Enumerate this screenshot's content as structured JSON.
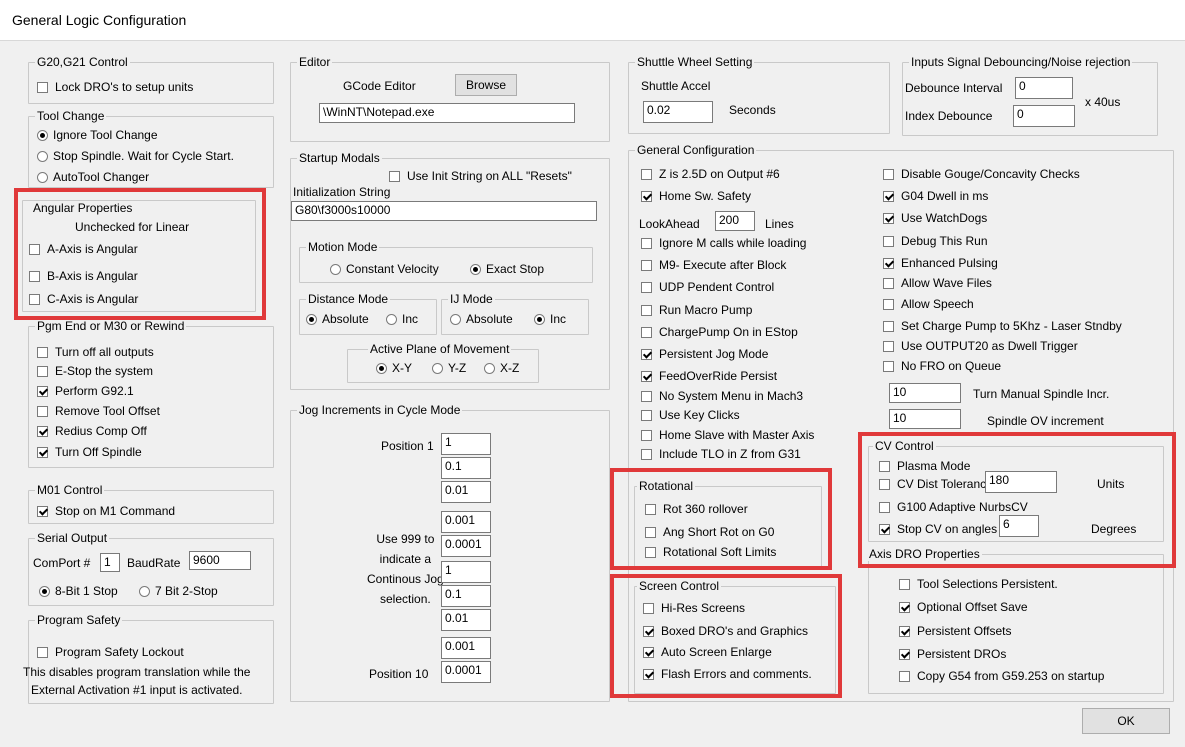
{
  "window": {
    "title": "General Logic Configuration"
  },
  "g20": {
    "title": "G20,G21 Control",
    "lock": {
      "label": "Lock DRO's to setup units",
      "checked": false
    }
  },
  "tool_change": {
    "title": "Tool Change",
    "options": [
      {
        "label": "Ignore Tool Change",
        "selected": true
      },
      {
        "label": "Stop Spindle. Wait for Cycle Start.",
        "selected": false
      },
      {
        "label": "AutoTool Changer",
        "selected": false
      }
    ]
  },
  "angular": {
    "title": "Angular Properties",
    "note": "Unchecked for Linear",
    "items": [
      {
        "label": "A-Axis is Angular",
        "checked": false
      },
      {
        "label": "B-Axis is Angular",
        "checked": false
      },
      {
        "label": "C-Axis is Angular",
        "checked": false
      }
    ]
  },
  "pgm_end": {
    "title": "Pgm End or M30 or Rewind",
    "items": [
      {
        "label": "Turn off all outputs",
        "checked": false
      },
      {
        "label": "E-Stop the system",
        "checked": false
      },
      {
        "label": "Perform G92.1",
        "checked": true
      },
      {
        "label": "Remove Tool Offset",
        "checked": false
      },
      {
        "label": "Redius Comp Off",
        "checked": true
      },
      {
        "label": "Turn Off Spindle",
        "checked": true
      }
    ]
  },
  "m01": {
    "title": "M01 Control",
    "stop": {
      "label": "Stop on M1 Command",
      "checked": true
    }
  },
  "serial": {
    "title": "Serial Output",
    "comport_label": "ComPort #",
    "comport_value": "1",
    "baud_label": "BaudRate",
    "baud_value": "9600",
    "options": [
      {
        "label": "8-Bit 1 Stop",
        "selected": true
      },
      {
        "label": "7 Bit 2-Stop",
        "selected": false
      }
    ]
  },
  "safety": {
    "title": "Program Safety",
    "lockout": {
      "label": "Program Safety Lockout",
      "checked": false
    },
    "note1": "This disables program translation while the",
    "note2": "External Activation #1 input is activated."
  },
  "editor": {
    "title": "Editor",
    "gcode_label": "GCode Editor",
    "browse_label": "Browse",
    "path": "\\WinNT\\Notepad.exe"
  },
  "startup": {
    "title": "Startup Modals",
    "use_init": {
      "label": "Use Init String on ALL  \"Resets\"",
      "checked": false
    },
    "init_label": "Initialization String",
    "init_value": "G80\\f3000s10000",
    "motion": {
      "title": "Motion Mode",
      "options": [
        {
          "label": "Constant Velocity",
          "selected": false
        },
        {
          "label": "Exact Stop",
          "selected": true
        }
      ]
    },
    "distance": {
      "title": "Distance Mode",
      "options": [
        {
          "label": "Absolute",
          "selected": true
        },
        {
          "label": "Inc",
          "selected": false
        }
      ]
    },
    "ij": {
      "title": "IJ Mode",
      "options": [
        {
          "label": "Absolute",
          "selected": false
        },
        {
          "label": "Inc",
          "selected": true
        }
      ]
    },
    "plane": {
      "title": "Active Plane of Movement",
      "options": [
        {
          "label": "X-Y",
          "selected": true
        },
        {
          "label": "Y-Z",
          "selected": false
        },
        {
          "label": "X-Z",
          "selected": false
        }
      ]
    }
  },
  "jog": {
    "title": "Jog Increments in Cycle Mode",
    "pos1_label": "Position 1",
    "pos10_label": "Position 10",
    "note": [
      "Use 999 to",
      "indicate a",
      "Continous Jog",
      "selection."
    ],
    "values": [
      "1",
      "0.1",
      "0.01",
      "0.001",
      "0.0001",
      "1",
      "0.1",
      "0.01",
      "0.001",
      "0.0001"
    ]
  },
  "shuttle": {
    "title": "Shuttle Wheel Setting",
    "accel_label": "Shuttle Accel",
    "accel_value": "0.02",
    "seconds_label": "Seconds"
  },
  "debounce": {
    "title": "Inputs Signal Debouncing/Noise rejection",
    "interval_label": "Debounce Interval",
    "interval_value": "0",
    "index_label": "Index Debounce",
    "index_value": "0",
    "unit": "x 40us"
  },
  "general": {
    "title": "General Configuration",
    "left": [
      {
        "label": "Z is 2.5D on Output #6",
        "checked": false
      },
      {
        "label": "Home Sw. Safety",
        "checked": true
      }
    ],
    "lookahead_label": "LookAhead",
    "lookahead_value": "200",
    "lines_label": "Lines",
    "left2": [
      {
        "label": "Ignore M calls while loading",
        "checked": false
      },
      {
        "label": "M9- Execute after Block",
        "checked": false
      },
      {
        "label": "UDP Pendent Control",
        "checked": false
      },
      {
        "label": "Run Macro Pump",
        "checked": false
      },
      {
        "label": "ChargePump On in EStop",
        "checked": false
      },
      {
        "label": "Persistent Jog Mode",
        "checked": true
      },
      {
        "label": "FeedOverRide Persist",
        "checked": true
      },
      {
        "label": "No System Menu in Mach3",
        "checked": false
      },
      {
        "label": "Use Key Clicks",
        "checked": false
      },
      {
        "label": "Home Slave with Master Axis",
        "checked": false
      },
      {
        "label": "Include TLO in Z from G31",
        "checked": false
      }
    ],
    "right": [
      {
        "label": "Disable Gouge/Concavity Checks",
        "checked": false
      },
      {
        "label": "G04 Dwell in ms",
        "checked": true
      },
      {
        "label": "Use WatchDogs",
        "checked": true
      },
      {
        "label": "Debug This Run",
        "checked": false
      },
      {
        "label": "Enhanced Pulsing",
        "checked": true
      },
      {
        "label": "Allow Wave Files",
        "checked": false
      },
      {
        "label": "Allow Speech",
        "checked": false
      },
      {
        "label": "Set Charge Pump to 5Khz  - Laser Stndby",
        "checked": false
      },
      {
        "label": "Use OUTPUT20 as Dwell Trigger",
        "checked": false
      },
      {
        "label": "No FRO on Queue",
        "checked": false
      }
    ],
    "spindle_incr_value": "10",
    "spindle_incr_label": "Turn Manual Spindle Incr.",
    "spindle_ov_value": "10",
    "spindle_ov_label": "Spindle OV increment"
  },
  "rotational": {
    "title": "Rotational",
    "items": [
      {
        "label": "Rot 360 rollover",
        "checked": false
      },
      {
        "label": "Ang Short Rot on G0",
        "checked": false
      },
      {
        "label": "Rotational Soft Limits",
        "checked": false
      }
    ]
  },
  "screen": {
    "title": "Screen Control",
    "items": [
      {
        "label": "Hi-Res Screens",
        "checked": false
      },
      {
        "label": "Boxed DRO's and Graphics",
        "checked": true
      },
      {
        "label": "Auto Screen Enlarge",
        "checked": true
      },
      {
        "label": "Flash Errors and comments.",
        "checked": true
      }
    ]
  },
  "cv": {
    "title": "CV Control",
    "plasma": {
      "label": "Plasma Mode",
      "checked": false
    },
    "tol": {
      "label": "CV Dist Tolerance",
      "checked": false,
      "value": "180",
      "unit": "Units"
    },
    "g100": {
      "label": "G100 Adaptive NurbsCV",
      "checked": false
    },
    "stop": {
      "label": "Stop CV on angles >",
      "checked": true,
      "value": "6",
      "unit": "Degrees"
    }
  },
  "axis_dro": {
    "title": "Axis DRO Properties",
    "items": [
      {
        "label": "Tool Selections Persistent.",
        "checked": false
      },
      {
        "label": "Optional Offset Save",
        "checked": true
      },
      {
        "label": "Persistent Offsets",
        "checked": true
      },
      {
        "label": "Persistent DROs",
        "checked": true
      },
      {
        "label": "Copy G54 from G59.253 on startup",
        "checked": false
      }
    ]
  },
  "ok_label": "OK",
  "colors": {
    "highlight": "#e0393a"
  }
}
